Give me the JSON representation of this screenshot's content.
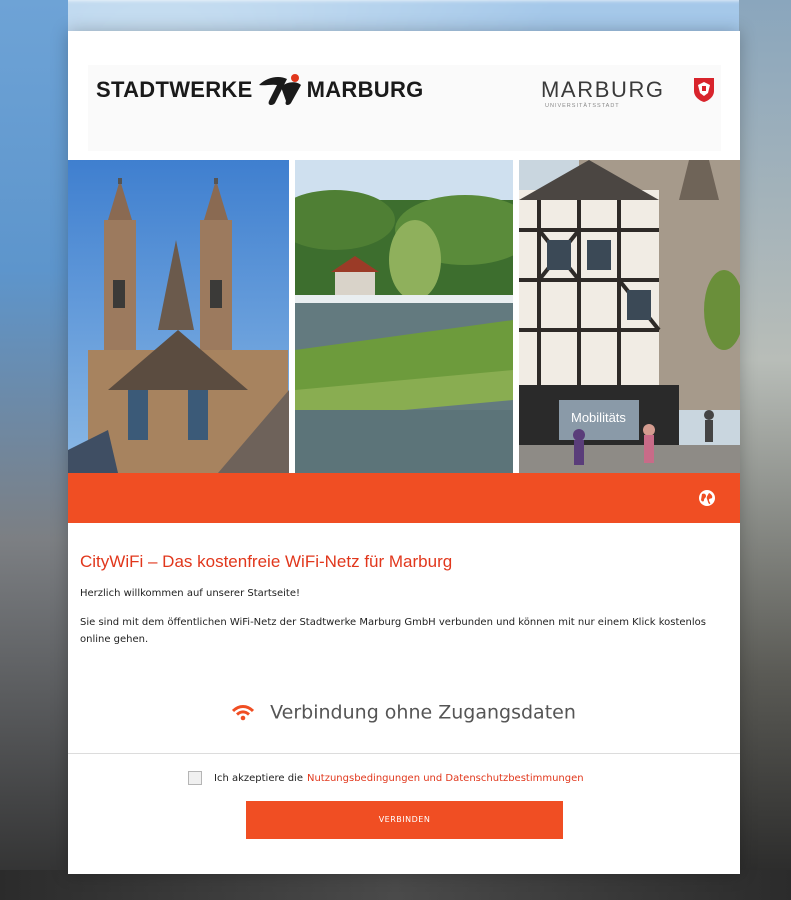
{
  "header": {
    "stadtwerke_logo_left": "STADTWERKE",
    "stadtwerke_logo_right": "MARBURG",
    "city_logo_word": "MARBURG",
    "city_logo_sub": "UNIVERSITÄTSSTADT"
  },
  "photos": [
    {
      "subject": "gothic church towers"
    },
    {
      "subject": "river weir and meadow"
    },
    {
      "subject": "half-timbered old town street",
      "sign_text": "Mobilitäts"
    }
  ],
  "band": {
    "icon": "globe-icon",
    "color": "#f04e23"
  },
  "content": {
    "title": "CityWiFi – Das kostenfreie WiFi-Netz für Marburg",
    "welcome": "Herzlich willkommen auf unserer Startseite!",
    "description": "Sie sind mit dem öffentlichen WiFi-Netz der Stadtwerke Marburg GmbH verbunden und können mit nur einem Klick kostenlos online gehen."
  },
  "connection": {
    "icon": "wifi-icon",
    "label": "Verbindung ohne Zugangsdaten"
  },
  "terms": {
    "prefix": "Ich akzeptiere die",
    "link": "Nutzungsbedingungen und Datenschutzbestimmungen",
    "checked": false
  },
  "connect_button": {
    "label": "VERBINDEN"
  },
  "colors": {
    "accent": "#f04e23",
    "title": "#e1371c"
  }
}
